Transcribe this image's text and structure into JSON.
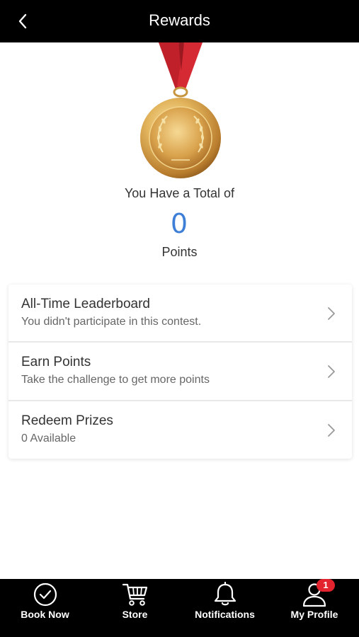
{
  "header": {
    "title": "Rewards",
    "back_icon": "chevron-left-icon"
  },
  "summary": {
    "total_label": "You Have a Total of",
    "points": "0",
    "points_label": "Points",
    "points_color": "#3d7fd6"
  },
  "menu": {
    "items": [
      {
        "title": "All-Time Leaderboard",
        "subtitle": "You didn't participate in this contest.",
        "icon": "chevron-right-icon"
      },
      {
        "title": "Earn Points",
        "subtitle": "Take the challenge to get more points",
        "icon": "chevron-right-icon"
      },
      {
        "title": "Redeem Prizes",
        "subtitle": "0 Available",
        "icon": "chevron-right-icon"
      }
    ]
  },
  "bottom_nav": {
    "items": [
      {
        "label": "Book Now",
        "icon": "check-circle-icon"
      },
      {
        "label": "Store",
        "icon": "cart-icon"
      },
      {
        "label": "Notifications",
        "icon": "bell-icon"
      },
      {
        "label": "My Profile",
        "icon": "user-icon"
      }
    ],
    "profile_badge": "1",
    "badge_color": "#e3232d"
  }
}
